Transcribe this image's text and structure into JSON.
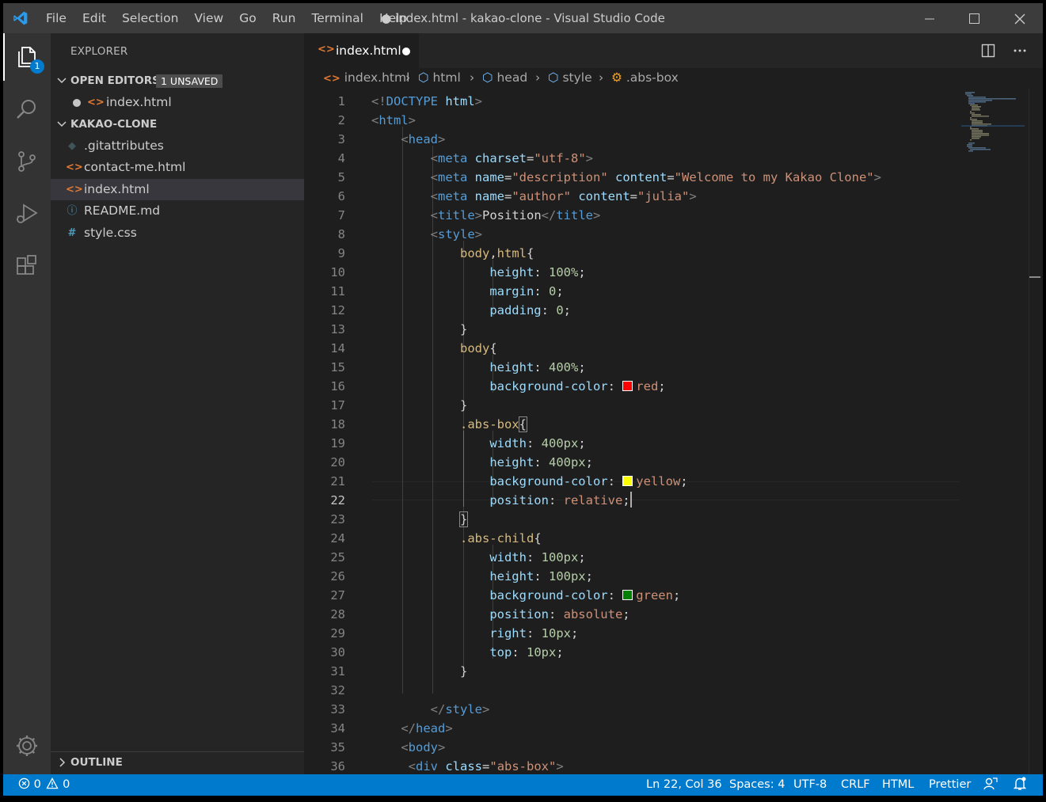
{
  "titlebar": {
    "menu": [
      "File",
      "Edit",
      "Selection",
      "View",
      "Go",
      "Run",
      "Terminal",
      "Help"
    ],
    "title": "● index.html - kakao-clone - Visual Studio Code"
  },
  "activity": {
    "explorer_badge": "1"
  },
  "sidebar": {
    "title": "EXPLORER",
    "open_editors": {
      "label": "OPEN EDITORS",
      "badge": "1 UNSAVED",
      "items": [
        "index.html"
      ]
    },
    "project": {
      "label": "KAKAO-CLONE",
      "files": [
        {
          "name": ".gitattributes",
          "icon": "git-icon"
        },
        {
          "name": "contact-me.html",
          "icon": "html-icon"
        },
        {
          "name": "index.html",
          "icon": "html-icon",
          "selected": true
        },
        {
          "name": "README.md",
          "icon": "info-icon"
        },
        {
          "name": "style.css",
          "icon": "css-icon"
        }
      ]
    },
    "outline": {
      "label": "OUTLINE"
    }
  },
  "tab": {
    "name": "index.html"
  },
  "breadcrumbs": [
    "index.html",
    "html",
    "head",
    "style",
    ".abs-box"
  ],
  "editor": {
    "line_numbers": [
      "1",
      "2",
      "3",
      "4",
      "5",
      "6",
      "7",
      "8",
      "9",
      "10",
      "11",
      "12",
      "13",
      "14",
      "15",
      "16",
      "17",
      "18",
      "19",
      "20",
      "21",
      "22",
      "23",
      "24",
      "25",
      "26",
      "27",
      "28",
      "29",
      "30",
      "31",
      "32",
      "33",
      "34",
      "35",
      "36"
    ],
    "current_line": 22,
    "code": {
      "l1": {
        "a": "<!",
        "b": "DOCTYPE",
        "c": " html",
        "d": ">"
      },
      "l2": {
        "a": "<",
        "b": "html",
        "c": ">"
      },
      "l3": {
        "a": "<",
        "b": "head",
        "c": ">"
      },
      "l4": {
        "a": "<",
        "b": "meta",
        "c": " charset",
        "d": "=",
        "e": "\"utf-8\"",
        "f": ">"
      },
      "l5": {
        "a": "<",
        "b": "meta",
        "c": " name",
        "d": "=",
        "e": "\"description\"",
        "f": " content",
        "g": "=",
        "h": "\"Welcome to my Kakao Clone\"",
        "i": ">"
      },
      "l6": {
        "a": "<",
        "b": "meta",
        "c": " name",
        "d": "=",
        "e": "\"author\"",
        "f": " content",
        "g": "=",
        "h": "\"julia\"",
        "i": ">"
      },
      "l7": {
        "a": "<",
        "b": "title",
        "c": ">",
        "d": "Position",
        "e": "</",
        "f": "title",
        "g": ">"
      },
      "l8": {
        "a": "<",
        "b": "style",
        "c": ">"
      },
      "l9": {
        "a": "body",
        "b": ",",
        "c": "html",
        "d": "{"
      },
      "l10": {
        "a": "height",
        "b": ": ",
        "c": "100%",
        "d": ";"
      },
      "l11": {
        "a": "margin",
        "b": ": ",
        "c": "0",
        "d": ";"
      },
      "l12": {
        "a": "padding",
        "b": ": ",
        "c": "0",
        "d": ";"
      },
      "l13": {
        "a": "}"
      },
      "l14": {
        "a": "body",
        "b": "{"
      },
      "l15": {
        "a": "height",
        "b": ": ",
        "c": "400%",
        "d": ";"
      },
      "l16": {
        "a": "background-color",
        "b": ": ",
        "c": "red",
        "d": ";",
        "swatch": "#ff0000"
      },
      "l17": {
        "a": "}"
      },
      "l18": {
        "a": ".abs-box",
        "b": "{"
      },
      "l19": {
        "a": "width",
        "b": ": ",
        "c": "400px",
        "d": ";"
      },
      "l20": {
        "a": "height",
        "b": ": ",
        "c": "400px",
        "d": ";"
      },
      "l21": {
        "a": "background-color",
        "b": ": ",
        "c": "yellow",
        "d": ";",
        "swatch": "#ffff00"
      },
      "l22": {
        "a": "position",
        "b": ": ",
        "c": "relative",
        "d": ";"
      },
      "l23": {
        "a": "}"
      },
      "l24": {
        "a": ".abs-child",
        "b": "{"
      },
      "l25": {
        "a": "width",
        "b": ": ",
        "c": "100px",
        "d": ";"
      },
      "l26": {
        "a": "height",
        "b": ": ",
        "c": "100px",
        "d": ";"
      },
      "l27": {
        "a": "background-color",
        "b": ": ",
        "c": "green",
        "d": ";",
        "swatch": "#008000"
      },
      "l28": {
        "a": "position",
        "b": ": ",
        "c": "absolute",
        "d": ";"
      },
      "l29": {
        "a": "right",
        "b": ": ",
        "c": "10px",
        "d": ";"
      },
      "l30": {
        "a": "top",
        "b": ": ",
        "c": "10px",
        "d": ";"
      },
      "l31": {
        "a": "}"
      },
      "l33": {
        "a": "</",
        "b": "style",
        "c": ">"
      },
      "l34": {
        "a": "</",
        "b": "head",
        "c": ">"
      },
      "l35": {
        "a": "<",
        "b": "body",
        "c": ">"
      },
      "l36": {
        "a": "<",
        "b": "div",
        "c": " class",
        "d": "=",
        "e": "\"abs-box\"",
        "f": ">"
      }
    }
  },
  "statusbar": {
    "errors": "0",
    "warnings": "0",
    "position": "Ln 22, Col 36",
    "spaces": "Spaces: 4",
    "encoding": "UTF-8",
    "eol": "CRLF",
    "language": "HTML",
    "formatter": "Prettier"
  },
  "colors": {
    "accent": "#007acc",
    "titlebar": "#3c3c3c",
    "sidebar": "#252526",
    "editor": "#1e1e1e"
  }
}
